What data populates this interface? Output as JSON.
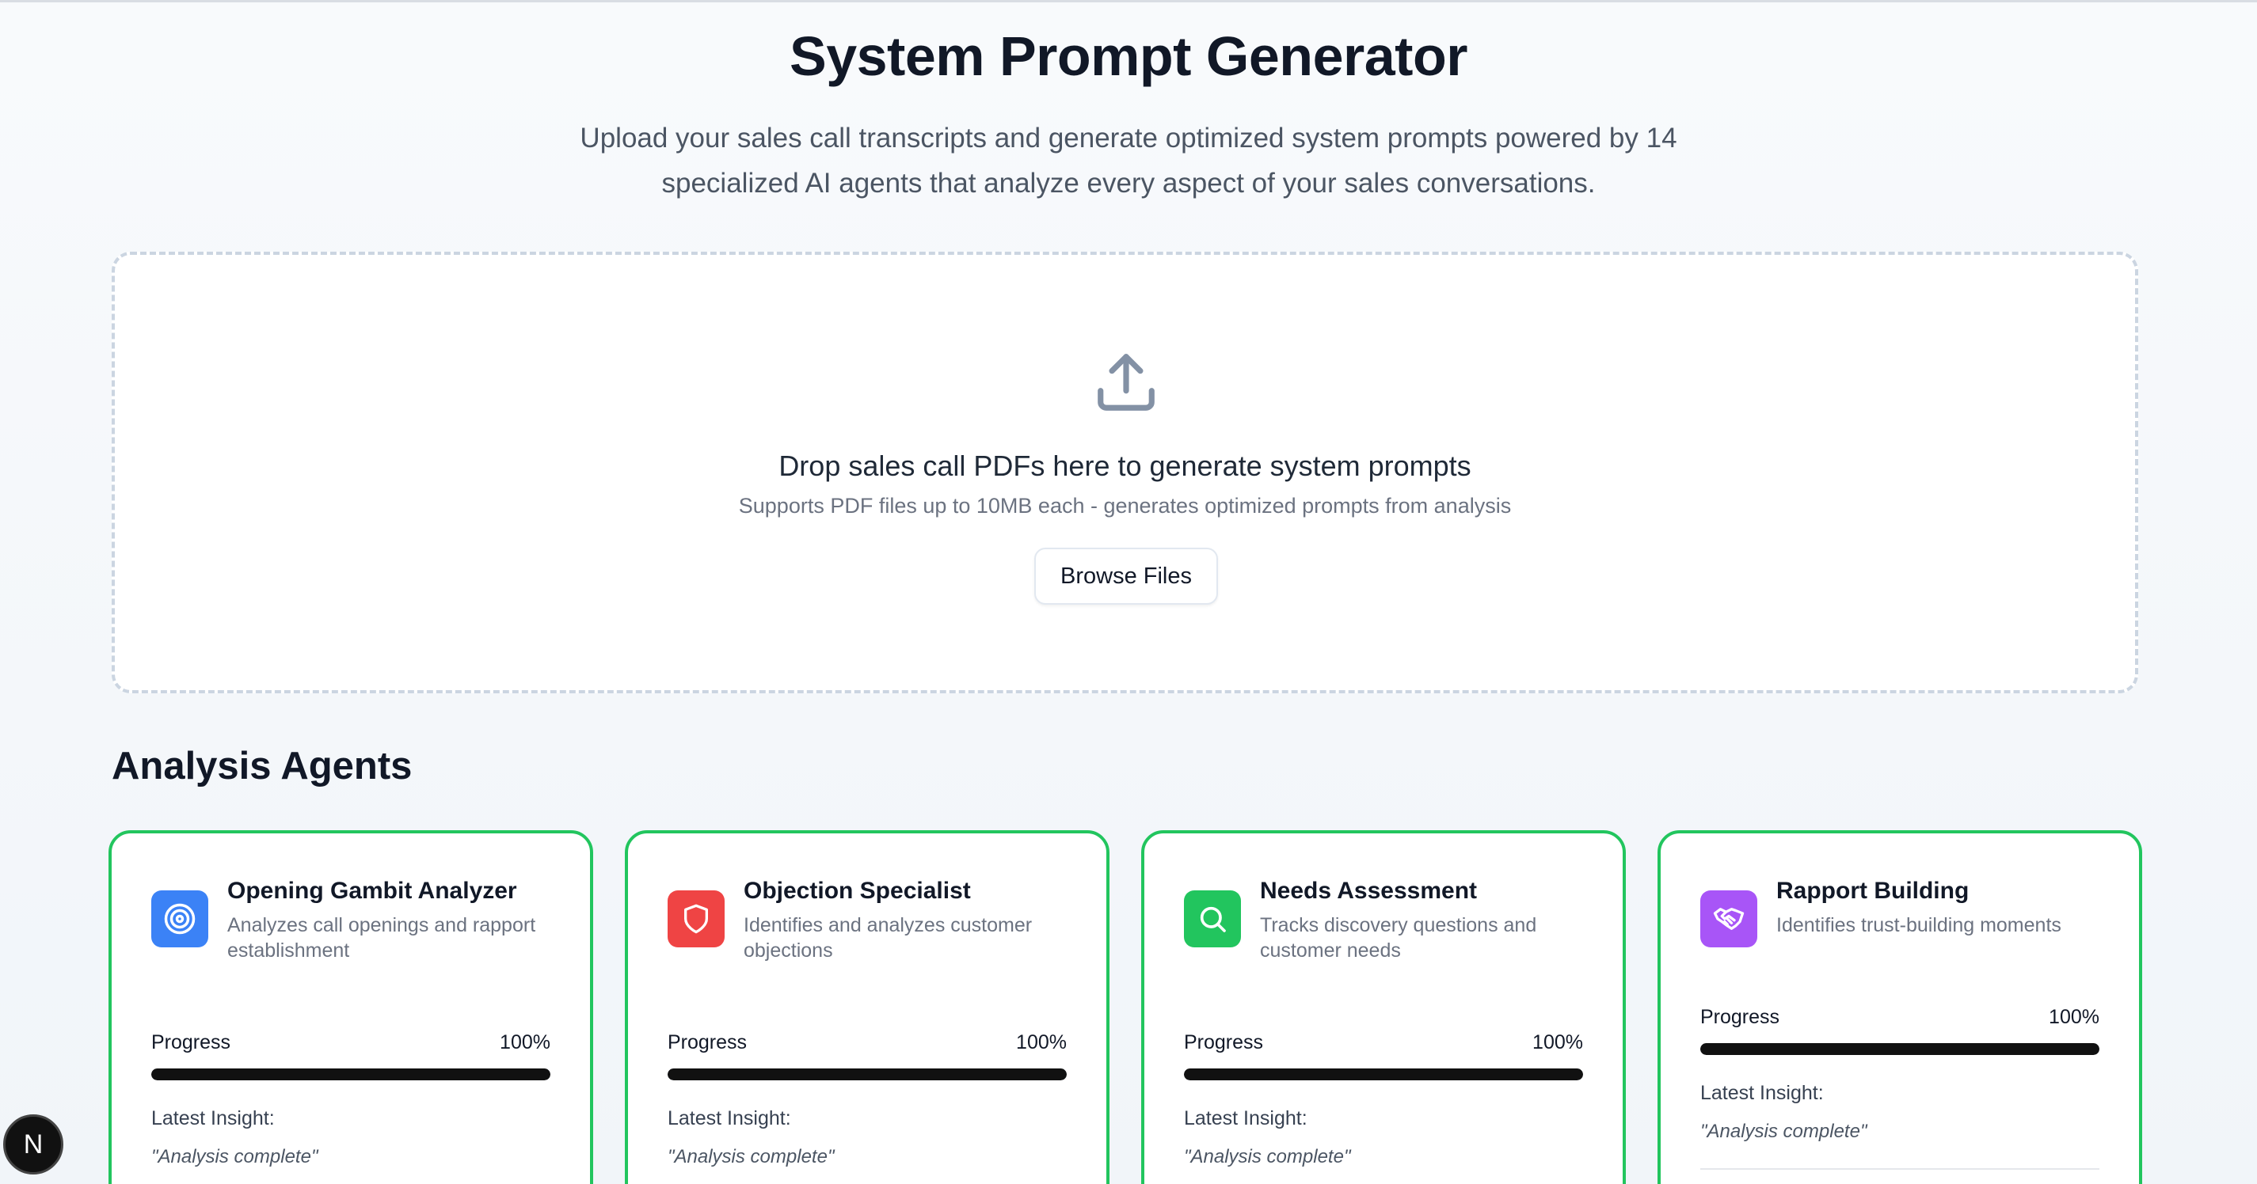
{
  "header": {
    "title": "System Prompt Generator",
    "subtitle": "Upload your sales call transcripts and generate optimized system prompts powered by 14 specialized AI agents that analyze every aspect of your sales conversations."
  },
  "dropzone": {
    "icon": "upload-icon",
    "title": "Drop sales call PDFs here to generate system prompts",
    "subtitle": "Supports PDF files up to 10MB each - generates optimized prompts from analysis",
    "browse_label": "Browse Files"
  },
  "agents_section": {
    "title": "Analysis Agents",
    "progress_label": "Progress",
    "insight_label": "Latest Insight:",
    "agents": [
      {
        "name": "Opening Gambit Analyzer",
        "description": "Analyzes call openings and rapport establishment",
        "icon": "target-icon",
        "color": "#3b82f6",
        "progress": 100,
        "progress_text": "100%",
        "insight": "\"Analysis complete\""
      },
      {
        "name": "Objection Specialist",
        "description": "Identifies and analyzes customer objections",
        "icon": "shield-icon",
        "color": "#ef4444",
        "progress": 100,
        "progress_text": "100%",
        "insight": "\"Analysis complete\""
      },
      {
        "name": "Needs Assessment",
        "description": "Tracks discovery questions and customer needs",
        "icon": "search-icon",
        "color": "#22c55e",
        "progress": 100,
        "progress_text": "100%",
        "insight": "\"Analysis complete\""
      },
      {
        "name": "Rapport Building",
        "description": "Identifies trust-building moments",
        "icon": "handshake-icon",
        "color": "#a855f7",
        "progress": 100,
        "progress_text": "100%",
        "insight": "\"Analysis complete\""
      }
    ]
  },
  "badge": {
    "label": "N"
  },
  "colors": {
    "accent_border": "#22c55e",
    "progress_fill": "#111111"
  }
}
